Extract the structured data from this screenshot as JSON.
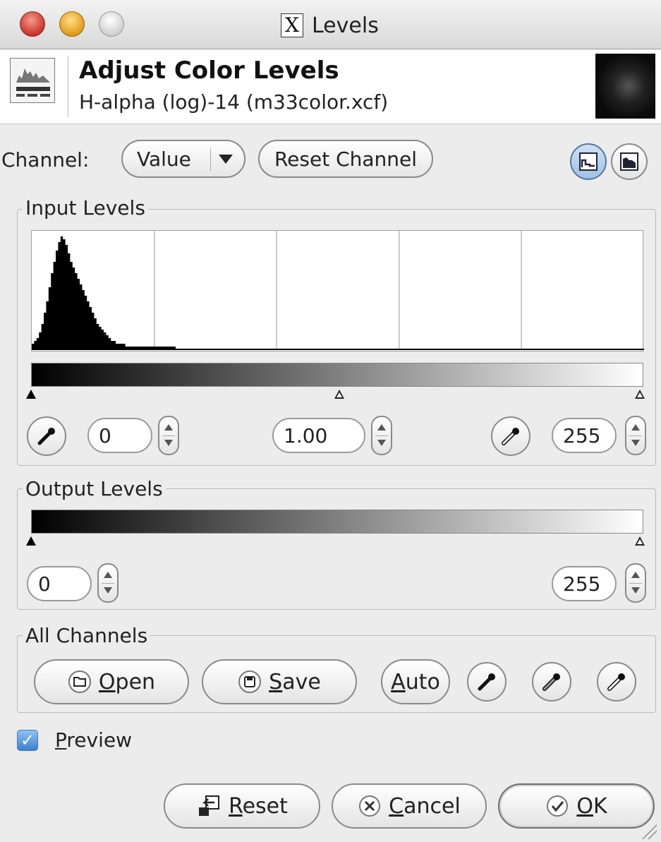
{
  "window": {
    "title": "Levels"
  },
  "header": {
    "title": "Adjust Color Levels",
    "subtitle": "H-alpha (log)-14 (m33color.xcf)"
  },
  "channel": {
    "label": "Channel:",
    "selected": "Value",
    "reset_label": "Reset Channel"
  },
  "input_levels": {
    "label": "Input Levels",
    "low": "0",
    "gamma": "1.00",
    "high": "255"
  },
  "output_levels": {
    "label": "Output Levels",
    "low": "0",
    "high": "255"
  },
  "all_channels": {
    "label": "All Channels",
    "open_label": "Open",
    "save_label": "Save",
    "auto_label": "Auto"
  },
  "preview": {
    "label": "Preview",
    "checked": true
  },
  "footer": {
    "reset_label": "Reset",
    "cancel_label": "Cancel",
    "ok_label": "OK"
  },
  "histogram": {
    "peak_value": 40,
    "bins": [
      2,
      3,
      4,
      6,
      9,
      13,
      17,
      22,
      27,
      31,
      35,
      38,
      40,
      39,
      37,
      34,
      31,
      29,
      27,
      25,
      23,
      21,
      19,
      17,
      15,
      13,
      11,
      9,
      8,
      7,
      6,
      5,
      4,
      3,
      3,
      2,
      2,
      2,
      2,
      1,
      1,
      1,
      1,
      1,
      1,
      1,
      1,
      1,
      1,
      1,
      1,
      1,
      1,
      1,
      1,
      1,
      1,
      1,
      1,
      1,
      0,
      0,
      0,
      0,
      0,
      0,
      0,
      0,
      0,
      0
    ]
  }
}
